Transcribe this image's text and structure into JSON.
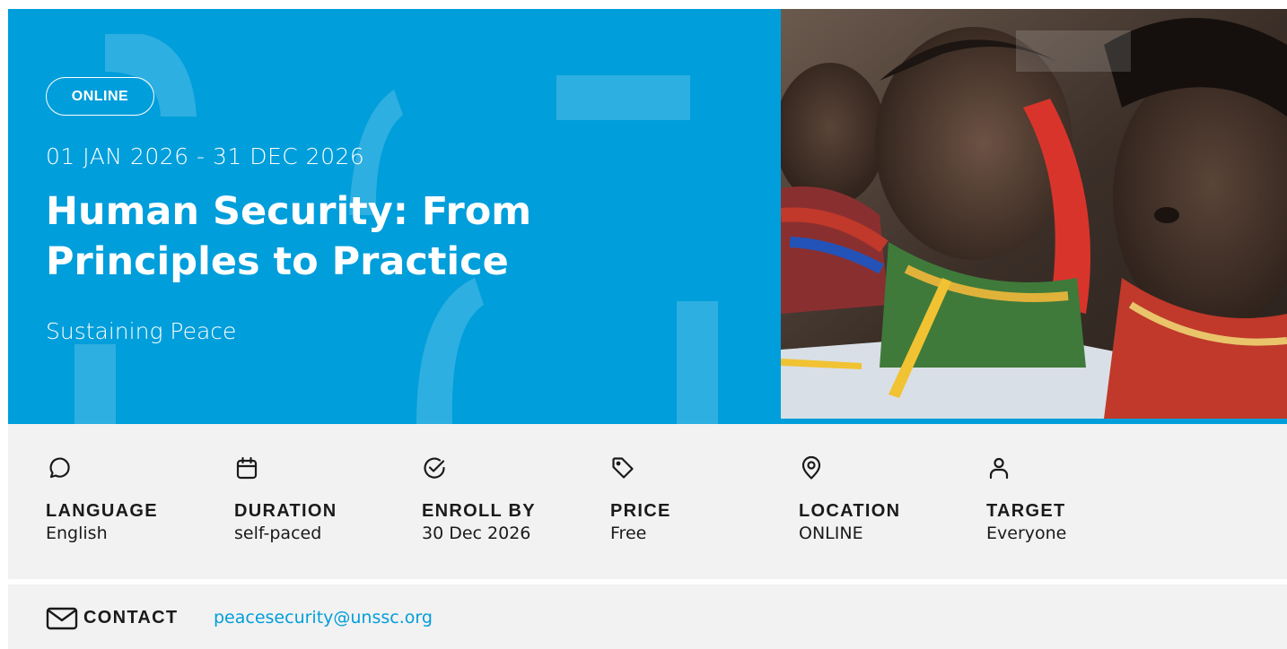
{
  "hero": {
    "badge": "ONLINE",
    "dates": "01 JAN 2026 - 31 DEC 2026",
    "title": "Human Security: From Principles to Practice",
    "subtitle": "Sustaining Peace",
    "accent_color": "#009edb"
  },
  "info": {
    "items": [
      {
        "icon": "chat-bubble-icon",
        "label": "LANGUAGE",
        "value": "English"
      },
      {
        "icon": "calendar-icon",
        "label": "DURATION",
        "value": "self-paced"
      },
      {
        "icon": "check-circle-icon",
        "label": "ENROLL BY",
        "value": "30 Dec 2026"
      },
      {
        "icon": "price-tag-icon",
        "label": "PRICE",
        "value": "Free"
      },
      {
        "icon": "location-pin-icon",
        "label": "LOCATION",
        "value": "ONLINE"
      },
      {
        "icon": "person-icon",
        "label": "TARGET",
        "value": "Everyone"
      }
    ]
  },
  "contact": {
    "icon": "envelope-icon",
    "label": "CONTACT",
    "email": "peacesecurity@unssc.org"
  }
}
